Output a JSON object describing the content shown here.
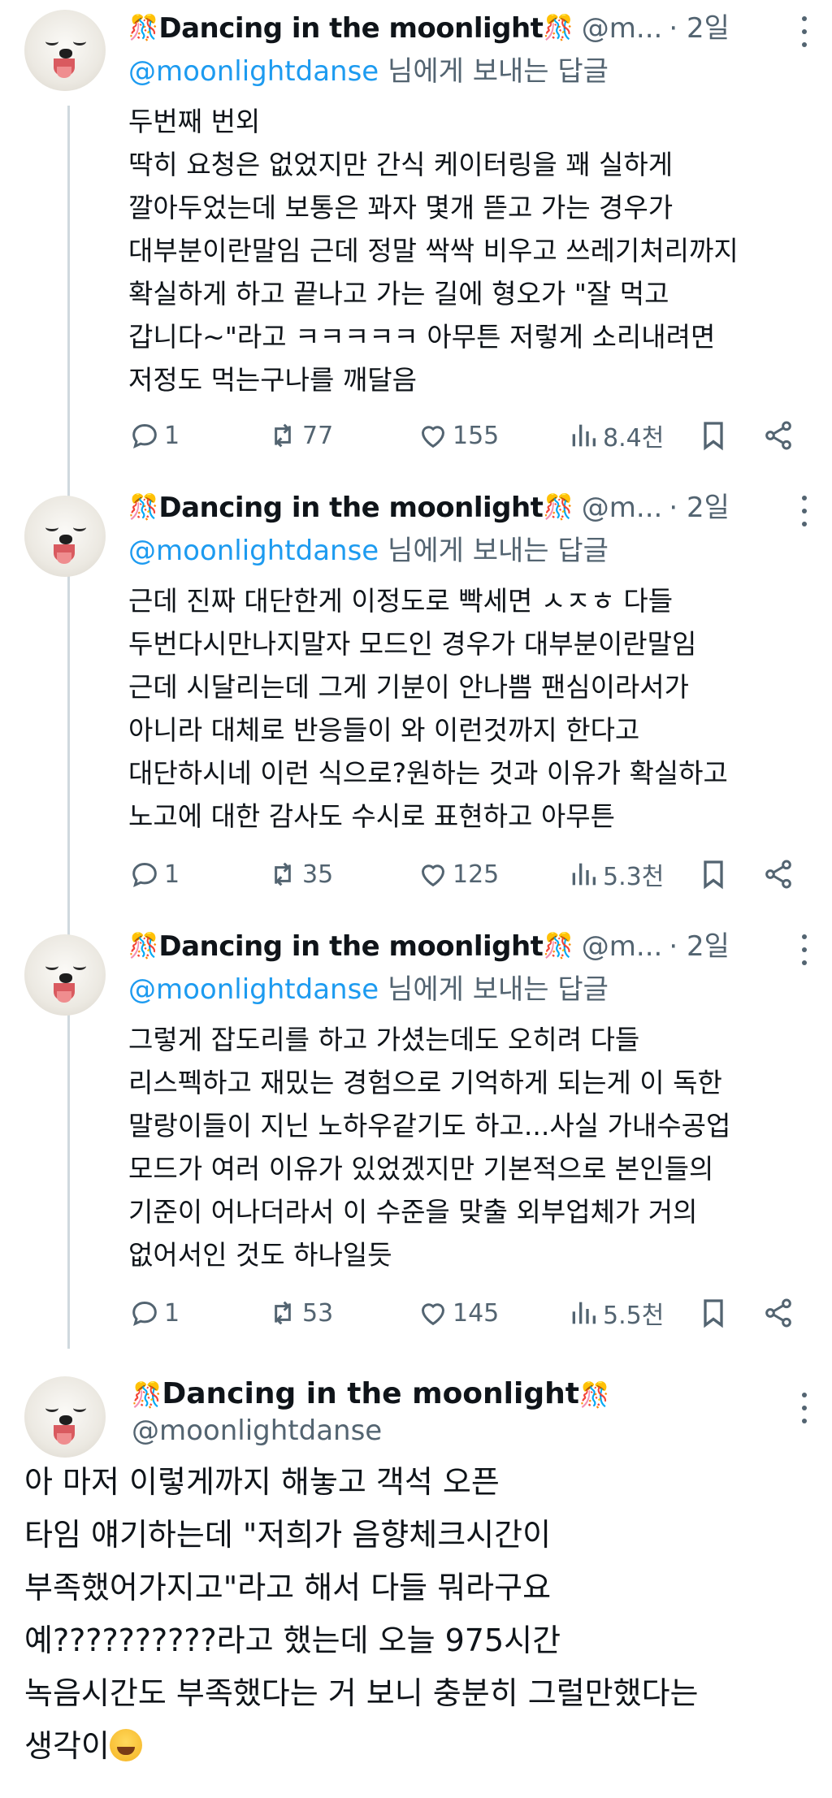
{
  "thread_replies": [
    {
      "display_name": "Dancing in the moonlight",
      "handle": "@m...",
      "time": "· 2일",
      "reply_mention": "@moonlightdanse",
      "reply_suffix": " 님에게 보내는 답글",
      "text": "두번째 번외\n딱히 요청은 없었지만 간식 케이터링을 꽤 실하게\n깔아두었는데 보통은 꽈자 몇개 뜯고 가는 경우가\n대부분이란말임 근데 정말 싹싹 비우고 쓰레기처리까지\n확실하게 하고 끝나고 가는 길에 형오가 \"잘 먹고\n갑니다~\"라고 ㅋㅋㅋㅋㅋ 아무튼 저렇게 소리내려면\n저정도 먹는구나를 깨달음",
      "replies": "1",
      "reposts": "77",
      "likes": "155",
      "views": "8.4천"
    },
    {
      "display_name": "Dancing in the moonlight",
      "handle": "@m...",
      "time": "· 2일",
      "reply_mention": "@moonlightdanse",
      "reply_suffix": " 님에게 보내는 답글",
      "text": "근데 진짜 대단한게 이정도로 빡세면 ㅅㅈㅎ 다들\n두번다시만나지말자 모드인 경우가 대부분이란말임\n근데 시달리는데 그게 기분이 안나쁨 팬심이라서가\n아니라 대체로 반응들이 와 이런것까지 한다고\n대단하시네 이런 식으로?원하는 것과 이유가 확실하고\n노고에 대한 감사도 수시로 표현하고 아무튼",
      "replies": "1",
      "reposts": "35",
      "likes": "125",
      "views": "5.3천"
    },
    {
      "display_name": "Dancing in the moonlight",
      "handle": "@m...",
      "time": "· 2일",
      "reply_mention": "@moonlightdanse",
      "reply_suffix": " 님에게 보내는 답글",
      "text": "그렇게 잡도리를 하고 가셨는데도 오히려 다들\n리스펙하고 재밌는 경험으로 기억하게 되는게 이 독한\n말랑이들이 지닌 노하우같기도 하고...사실 가내수공업\n모드가 여러 이유가 있었겠지만 기본적으로 본인들의\n기준이 어나더라서 이 수준을 맞출 외부업체가 거의\n없어서인 것도 하나일듯",
      "replies": "1",
      "reposts": "53",
      "likes": "145",
      "views": "5.5천"
    }
  ],
  "main_tweet": {
    "display_name": "Dancing in the moonlight",
    "handle": "@moonlightdanse",
    "text": "아 마저 이렇게까지 해놓고 객석 오픈\n타임 얘기하는데 \"저희가 음향체크시간이\n부족했어가지고\"라고 해서 다들 뭐라구요\n예??????????라고 했는데 오늘 975시간\n녹음시간도 부족했다는 거 보니 충분히 그럴만했다는\n생각이",
    "emoji": "joy-emoji"
  },
  "decoration": "🎊"
}
